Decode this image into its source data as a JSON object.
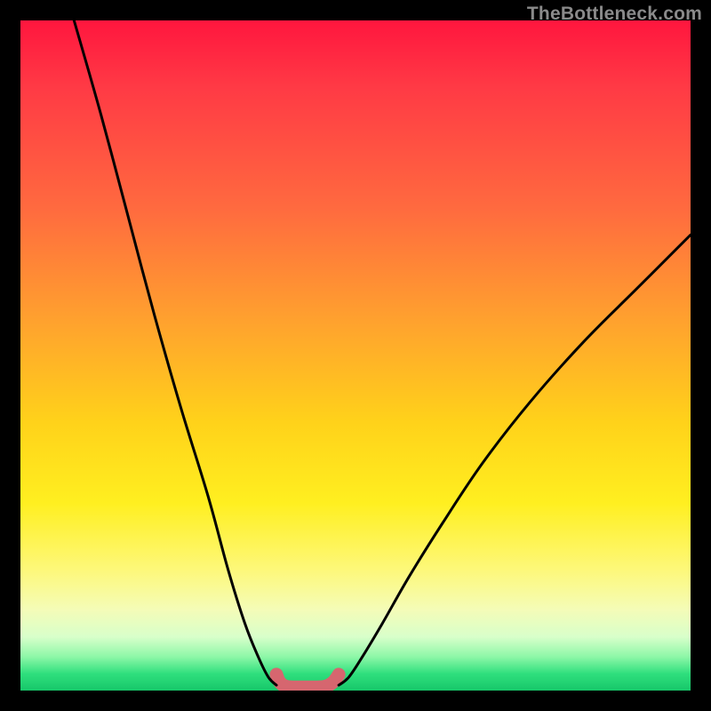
{
  "watermark": "TheBottleneck.com",
  "chart_data": {
    "type": "line",
    "title": "",
    "xlabel": "",
    "ylabel": "",
    "xlim": [
      0,
      100
    ],
    "ylim": [
      0,
      100
    ],
    "grid": false,
    "legend": false,
    "annotations": [
      {
        "text": "TheBottleneck.com",
        "position": "top-right",
        "color": "#8a8a8a"
      }
    ],
    "series": [
      {
        "name": "left-curve",
        "color": "#000000",
        "width": 2,
        "x": [
          8,
          12,
          16,
          20,
          24,
          28,
          31,
          33.5,
          35.5,
          37,
          38.2
        ],
        "y": [
          100,
          86,
          71,
          56,
          42,
          29,
          18,
          10,
          5,
          2,
          0.8
        ]
      },
      {
        "name": "right-curve",
        "color": "#000000",
        "width": 2,
        "x": [
          47.5,
          49,
          51,
          54,
          58,
          63,
          69,
          76,
          84,
          92,
          100
        ],
        "y": [
          0.8,
          2,
          5,
          10,
          17,
          25,
          34,
          43,
          52,
          60,
          68
        ]
      },
      {
        "name": "valley-marker",
        "color": "#d6666f",
        "width": 10,
        "cap": "round",
        "x": [
          38.2,
          38.6,
          39.2,
          40,
          41,
          42.5,
          44,
          45.2,
          46,
          46.8,
          47.5
        ],
        "y": [
          2.4,
          1.4,
          0.8,
          0.55,
          0.5,
          0.5,
          0.5,
          0.55,
          0.8,
          1.4,
          2.4
        ]
      }
    ],
    "background_gradient": {
      "direction": "top-to-bottom",
      "stops": [
        {
          "offset": 0.0,
          "color": "#ff163e"
        },
        {
          "offset": 0.28,
          "color": "#ff6a3f"
        },
        {
          "offset": 0.6,
          "color": "#ffd21a"
        },
        {
          "offset": 0.82,
          "color": "#fdf87a"
        },
        {
          "offset": 0.93,
          "color": "#b7f9bb"
        },
        {
          "offset": 1.0,
          "color": "#17c76a"
        }
      ]
    }
  }
}
